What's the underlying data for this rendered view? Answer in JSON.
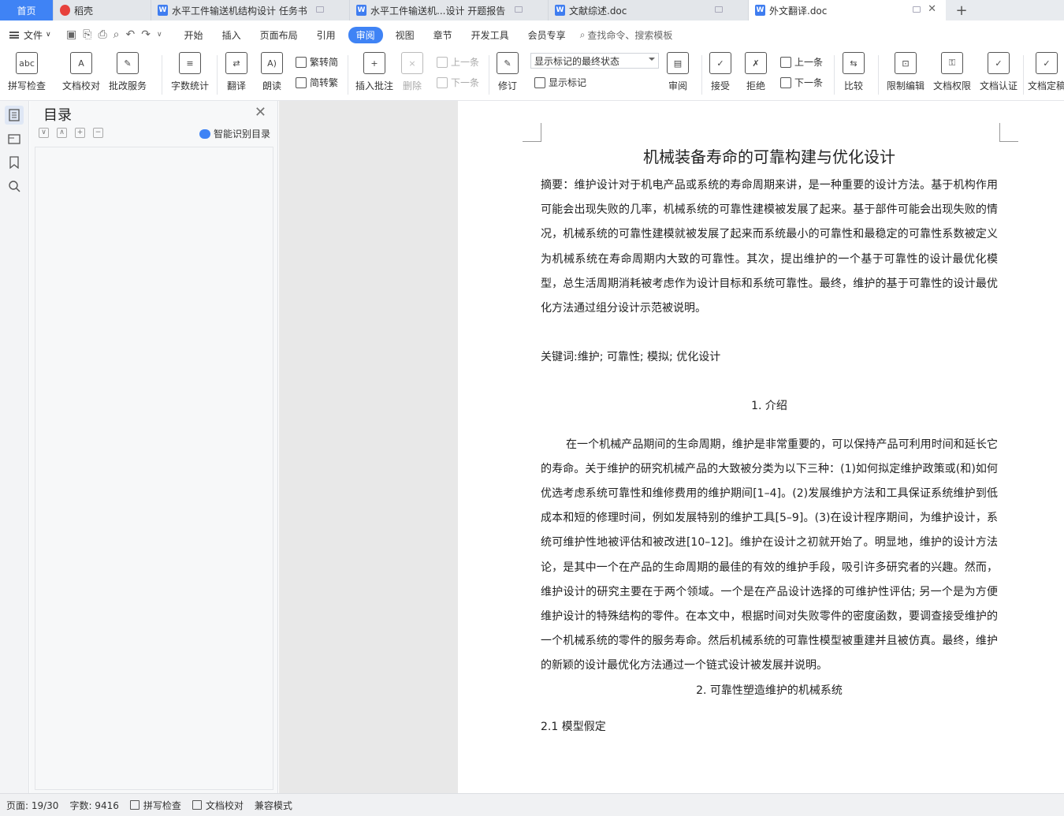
{
  "tabs": [
    {
      "label": "首页"
    },
    {
      "label": "稻壳"
    },
    {
      "label": "水平工件输送机结构设计 任务书"
    },
    {
      "label": "水平工件输送机...设计 开题报告"
    },
    {
      "label": "文献综述.doc"
    },
    {
      "label": "外文翻译.doc"
    }
  ],
  "menu": {
    "file": "文件",
    "items": [
      "开始",
      "插入",
      "页面布局",
      "引用",
      "审阅",
      "视图",
      "章节",
      "开发工具",
      "会员专享"
    ],
    "active": "审阅",
    "search": "查找命令、搜索模板"
  },
  "ribbon": {
    "spell": "拼写检查",
    "proof": "文档校对",
    "revise_service": "批改服务",
    "word_count": "字数统计",
    "translate": "翻译",
    "read": "朗读",
    "t2s": "繁转简",
    "s2t": "简转繁",
    "insert_comment": "插入批注",
    "delete": "删除",
    "prev": "上一条",
    "next": "下一条",
    "track": "修订",
    "markup_select": "显示标记的最终状态",
    "show_markup": "显示标记",
    "review": "审阅",
    "accept": "接受",
    "reject": "拒绝",
    "prev2": "上一条",
    "next2": "下一条",
    "compare": "比较",
    "restrict": "限制编辑",
    "permission": "文档权限",
    "certify": "文档认证",
    "finalize": "文档定稿"
  },
  "toc": {
    "title": "目录",
    "smart": "智能识别目录"
  },
  "document": {
    "title": "机械装备寿命的可靠构建与优化设计",
    "abstract": "摘要：维护设计对于机电产品或系统的寿命周期来讲，是一种重要的设计方法。基于机构作用可能会出现失败的几率，机械系统的可靠性建模被发展了起来。基于部件可能会出现失败的情况，机械系统的可靠性建模就被发展了起来而系统最小的可靠性和最稳定的可靠性系数被定义为机械系统在寿命周期内大致的可靠性。其次，提出维护的一个基于可靠性的设计最优化模型，总生活周期消耗被考虑作为设计目标和系统可靠性。最终，维护的基于可靠性的设计最优化方法通过组分设计示范被说明。",
    "keywords": "关键词:维护; 可靠性; 模拟; 优化设计",
    "sec1": "1. 介绍",
    "body": "在一个机械产品期间的生命周期，维护是非常重要的，可以保持产品可利用时间和延长它的寿命。关于维护的研究机械产品的大致被分类为以下三种：(1)如何拟定维护政策或(和)如何优选考虑系统可靠性和维修费用的维护期间[1–4]。(2)发展维护方法和工具保证系统维护到低成本和短的修理时间，例如发展特别的维护工具[5–9]。(3)在设计程序期间，为维护设计，系统可维护性地被评估和被改进[10–12]。维护在设计之初就开始了。明显地，维护的设计方法论，是其中一个在产品的生命周期的最佳的有效的维护手段，吸引许多研究者的兴趣。然而，维护设计的研究主要在于两个领域。一个是在产品设计选择的可维护性评估; 另一个是为方便维护设计的特殊结构的零件。在本文中，根据时间对失败零件的密度函数，要调查接受维护的一个机械系统的零件的服务寿命。然后机械系统的可靠性模型被重建并且被仿真。最终，维护的新颖的设计最优化方法通过一个链式设计被发展并说明。",
    "sec2": "2. 可靠性塑造维护的机械系统",
    "sec21": "2.1 模型假定"
  },
  "status": {
    "page": "页面: 19/30",
    "words": "字数: 9416",
    "spell": "拼写检查",
    "proof": "文档校对",
    "compat": "兼容模式"
  }
}
